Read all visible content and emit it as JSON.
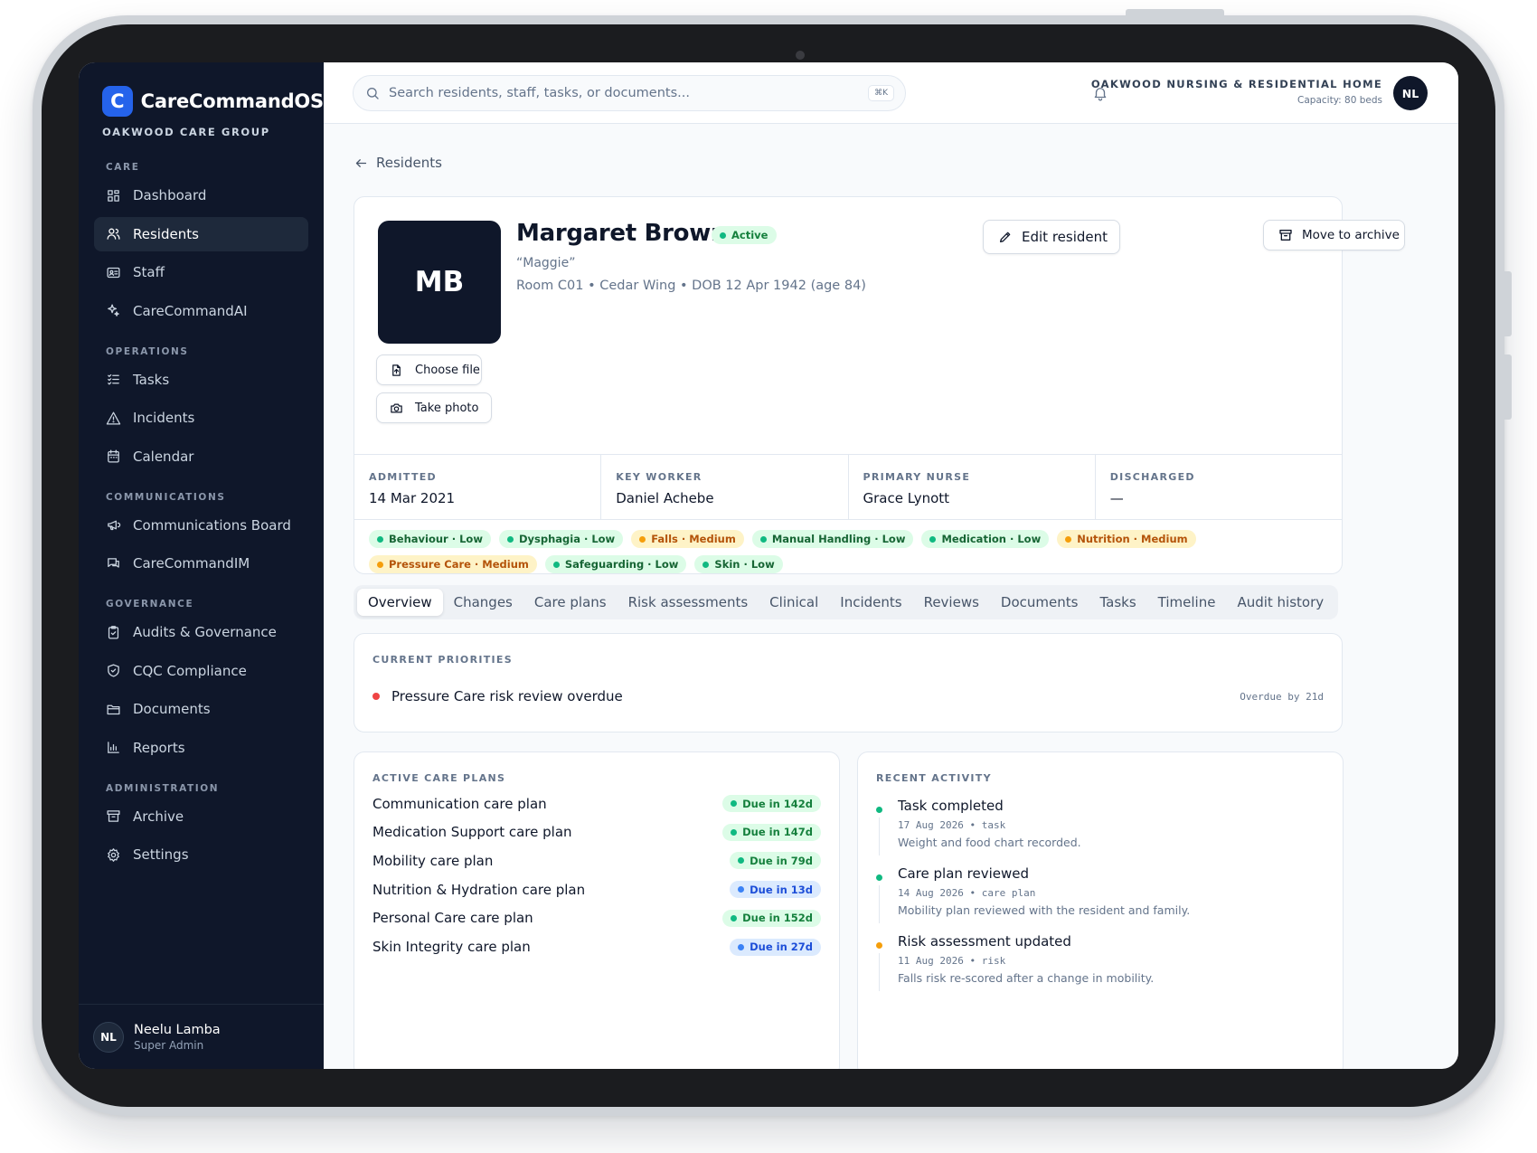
{
  "brand": {
    "logo_letter": "C",
    "name": "CareCommandOS",
    "org": "OAKWOOD CARE GROUP"
  },
  "sidebar": {
    "sections": [
      {
        "label": "CARE",
        "items": [
          {
            "label": "Dashboard",
            "icon": "dashboard-icon"
          },
          {
            "label": "Residents",
            "icon": "users-icon",
            "active": true
          },
          {
            "label": "Staff",
            "icon": "id-card-icon"
          },
          {
            "label": "CareCommandAI",
            "icon": "sparkles-icon"
          }
        ]
      },
      {
        "label": "OPERATIONS",
        "items": [
          {
            "label": "Tasks",
            "icon": "checklist-icon"
          },
          {
            "label": "Incidents",
            "icon": "warning-icon"
          },
          {
            "label": "Calendar",
            "icon": "calendar-icon"
          }
        ]
      },
      {
        "label": "COMMUNICATIONS",
        "items": [
          {
            "label": "Communications Board",
            "icon": "megaphone-icon"
          },
          {
            "label": "CareCommandIM",
            "icon": "chat-icon"
          }
        ]
      },
      {
        "label": "GOVERNANCE",
        "items": [
          {
            "label": "Audits & Governance",
            "icon": "clipboard-check-icon"
          },
          {
            "label": "CQC Compliance",
            "icon": "shield-check-icon"
          },
          {
            "label": "Documents",
            "icon": "folder-icon"
          },
          {
            "label": "Reports",
            "icon": "bar-chart-icon"
          }
        ]
      },
      {
        "label": "ADMINISTRATION",
        "items": [
          {
            "label": "Archive",
            "icon": "archive-icon"
          },
          {
            "label": "Settings",
            "icon": "gear-icon"
          }
        ]
      }
    ],
    "user": {
      "initials": "NL",
      "name": "Neelu Lamba",
      "role": "Super Admin"
    }
  },
  "topbar": {
    "search_placeholder": "Search residents, staff, tasks, or documents...",
    "shortcut": "⌘K",
    "home_name": "OAKWOOD NURSING & RESIDENTIAL HOME",
    "capacity": "Capacity: 80 beds",
    "user_initials": "NL"
  },
  "back_label": "Residents",
  "resident": {
    "initials": "MB",
    "name": "Margaret Brown",
    "status": "Active",
    "nickname": "“Maggie”",
    "details": "Room C01 • Cedar Wing • DOB 12 Apr 1942 (age 84)",
    "choose_file_label": "Choose file",
    "take_photo_label": "Take photo",
    "edit_label": "Edit resident",
    "archive_label": "Move to archive",
    "facts": [
      {
        "label": "ADMITTED",
        "value": "14 Mar 2021"
      },
      {
        "label": "KEY WORKER",
        "value": "Daniel Achebe"
      },
      {
        "label": "PRIMARY NURSE",
        "value": "Grace Lynott"
      },
      {
        "label": "DISCHARGED",
        "value": "—"
      }
    ],
    "risks": [
      {
        "label": "Behaviour · Low",
        "level": "low"
      },
      {
        "label": "Dysphagia · Low",
        "level": "low"
      },
      {
        "label": "Falls · Medium",
        "level": "medium"
      },
      {
        "label": "Manual Handling · Low",
        "level": "low"
      },
      {
        "label": "Medication · Low",
        "level": "low"
      },
      {
        "label": "Nutrition · Medium",
        "level": "medium"
      },
      {
        "label": "Pressure Care · Medium",
        "level": "medium"
      },
      {
        "label": "Safeguarding · Low",
        "level": "low"
      },
      {
        "label": "Skin · Low",
        "level": "low"
      }
    ]
  },
  "tabs": [
    "Overview",
    "Changes",
    "Care plans",
    "Risk assessments",
    "Clinical",
    "Incidents",
    "Reviews",
    "Documents",
    "Tasks",
    "Timeline",
    "Audit history"
  ],
  "active_tab": "Overview",
  "priorities": {
    "label": "CURRENT PRIORITIES",
    "items": [
      {
        "text": "Pressure Care risk review overdue",
        "due": "Overdue by 21d"
      }
    ]
  },
  "care_plans": {
    "label": "ACTIVE CARE PLANS",
    "items": [
      {
        "name": "Communication care plan",
        "due": "Due in 142d",
        "state": "ok"
      },
      {
        "name": "Medication Support care plan",
        "due": "Due in 147d",
        "state": "ok"
      },
      {
        "name": "Mobility care plan",
        "due": "Due in 79d",
        "state": "ok"
      },
      {
        "name": "Nutrition & Hydration care plan",
        "due": "Due in 13d",
        "state": "soon"
      },
      {
        "name": "Personal Care care plan",
        "due": "Due in 152d",
        "state": "ok"
      },
      {
        "name": "Skin Integrity care plan",
        "due": "Due in 27d",
        "state": "soon"
      }
    ]
  },
  "activity": {
    "label": "RECENT ACTIVITY",
    "items": [
      {
        "title": "Task completed",
        "meta": "17 Aug 2026 • task",
        "desc": "Weight and food chart recorded.",
        "color": "#10b981"
      },
      {
        "title": "Care plan reviewed",
        "meta": "14 Aug 2026 • care plan",
        "desc": "Mobility plan reviewed with the resident and family.",
        "color": "#10b981"
      },
      {
        "title": "Risk assessment updated",
        "meta": "11 Aug 2026 • risk",
        "desc": "Falls risk re-scored after a change in mobility.",
        "color": "#f59e0b"
      }
    ]
  },
  "colors": {
    "accent": "#2563eb",
    "sidebar_bg": "#0f172a",
    "low_dot": "#10b981",
    "medium_dot": "#f59e0b",
    "soon_dot": "#3b82f6",
    "alert_dot": "#ef4444"
  }
}
